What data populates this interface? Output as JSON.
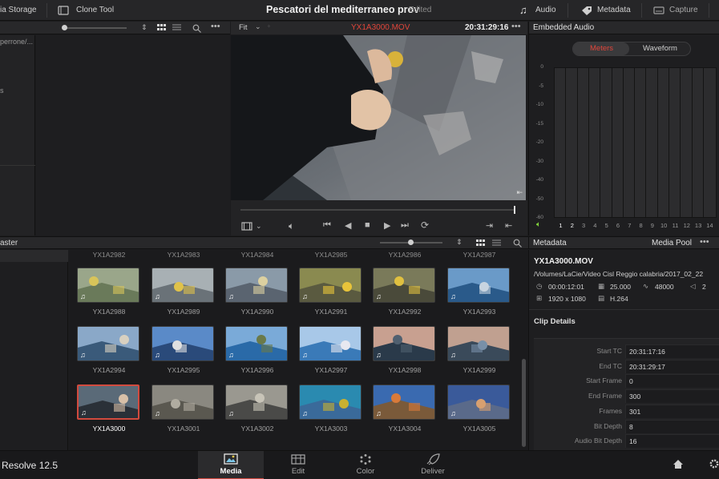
{
  "topbar": {
    "media_storage": "ia Storage",
    "clone_tool": "Clone Tool",
    "project_title": "Pescatori del mediterraneo prov",
    "edited": "Edited",
    "audio": "Audio",
    "metadata": "Metadata",
    "capture": "Capture"
  },
  "left": {
    "path_fragment": "perrone/...",
    "fragment_s": "s",
    "master": "aster"
  },
  "viewer": {
    "zoom": "Fit",
    "clip_name": "YX1A3000.MOV",
    "timecode": "20:31:29:16"
  },
  "audio_panel": {
    "title": "Embedded Audio",
    "tab_meters": "Meters",
    "tab_waveform": "Waveform",
    "scale": [
      "0",
      "-5",
      "-10",
      "-15",
      "-20",
      "-30",
      "-40",
      "-50",
      "-60"
    ],
    "channels": [
      "1",
      "2",
      "3",
      "4",
      "5",
      "6",
      "7",
      "8",
      "9",
      "10",
      "11",
      "12",
      "13",
      "14"
    ]
  },
  "clips": {
    "top_row": [
      "YX1A2982",
      "YX1A2983",
      "YX1A2984",
      "YX1A2985",
      "YX1A2986",
      "YX1A2987"
    ],
    "rows": [
      [
        "YX1A2988",
        "YX1A2989",
        "YX1A2990",
        "YX1A2991",
        "YX1A2992",
        "YX1A2993"
      ],
      [
        "YX1A2994",
        "YX1A2995",
        "YX1A2996",
        "YX1A2997",
        "YX1A2998",
        "YX1A2999"
      ],
      [
        "YX1A3000",
        "YX1A3001",
        "YX1A3002",
        "YX1A3003",
        "YX1A3004",
        "YX1A3005"
      ]
    ]
  },
  "metadata": {
    "title": "Metadata",
    "media_pool": "Media Pool",
    "clip_name": "YX1A3000.MOV",
    "path": "/Volumes/LaCie/Video Cisl Reggio calabria/2017_02_22",
    "duration": "00:00:12:01",
    "fps": "25.000",
    "sample_rate": "48000",
    "channels": "2",
    "resolution": "1920 x 1080",
    "codec": "H.264",
    "clip_details_title": "Clip Details",
    "details": [
      {
        "key": "Start TC",
        "value": "20:31:17:16"
      },
      {
        "key": "End TC",
        "value": "20:31:29:17"
      },
      {
        "key": "Start Frame",
        "value": "0"
      },
      {
        "key": "End Frame",
        "value": "300"
      },
      {
        "key": "Frames",
        "value": "301"
      },
      {
        "key": "Bit Depth",
        "value": "8"
      },
      {
        "key": "Audio Bit Depth",
        "value": "16"
      }
    ]
  },
  "footer": {
    "app_name": "Resolve 12.5",
    "tabs": [
      "Media",
      "Edit",
      "Color",
      "Deliver"
    ]
  },
  "colors": {
    "accent_red": "#d24a3e",
    "meter_green": "#7fd13b"
  }
}
